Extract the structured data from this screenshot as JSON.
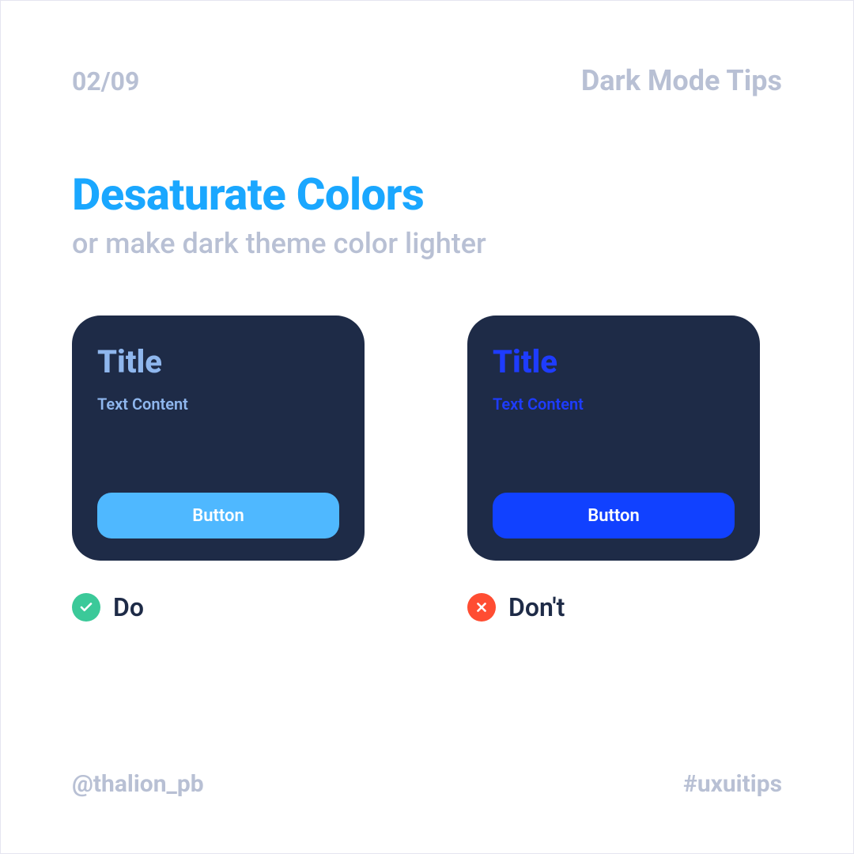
{
  "header": {
    "page_number": "02/09",
    "series_title": "Dark Mode Tips"
  },
  "main": {
    "title": "Desaturate Colors",
    "subtitle": "or make dark theme color lighter"
  },
  "cards": {
    "do": {
      "title": "Title",
      "text": "Text Content",
      "button": "Button",
      "label": "Do"
    },
    "dont": {
      "title": "Title",
      "text": "Text Content",
      "button": "Button",
      "label": "Don't"
    }
  },
  "footer": {
    "handle": "@thalion_pb",
    "hashtag": "#uxuitips"
  },
  "colors": {
    "accent_blue": "#1aa7ff",
    "muted_text": "#b8c0d4",
    "card_bg": "#1e2b47",
    "do_text": "#8fb7ee",
    "do_button": "#4fb8ff",
    "dont_text": "#1e3cff",
    "dont_button": "#1141ff",
    "success": "#3bc999",
    "error": "#ff4d32"
  }
}
